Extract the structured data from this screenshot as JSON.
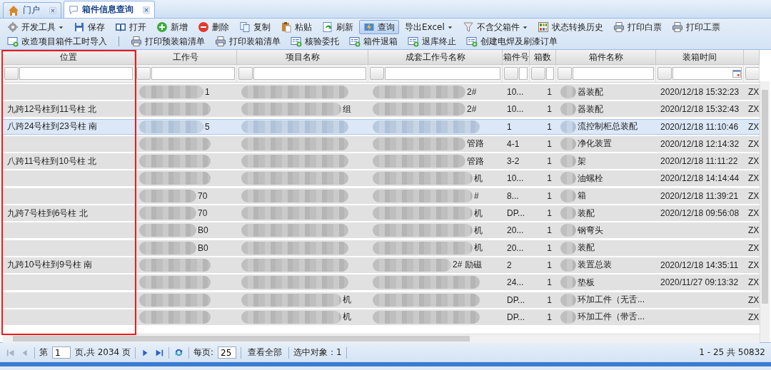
{
  "tabs": [
    {
      "label": "门户",
      "selected": false
    },
    {
      "label": "箱件信息查询",
      "selected": true
    }
  ],
  "toolbar": [
    {
      "items": [
        {
          "label": "开发工具",
          "kind": "dropdown",
          "pressed": false
        },
        {
          "label": "保存",
          "kind": "button",
          "pressed": false
        },
        {
          "label": "打开",
          "kind": "button",
          "pressed": false
        },
        {
          "label": "新增",
          "kind": "button",
          "pressed": false
        },
        {
          "label": "删除",
          "kind": "button",
          "pressed": false
        },
        {
          "label": "复制",
          "kind": "button",
          "pressed": false
        },
        {
          "label": "粘贴",
          "kind": "button",
          "pressed": false
        },
        {
          "label": "刷新",
          "kind": "button",
          "pressed": false
        },
        {
          "label": "查询",
          "kind": "button",
          "pressed": true
        },
        {
          "label": "导出Excel",
          "kind": "dropdown",
          "pressed": false
        },
        {
          "label": "不含父箱件",
          "kind": "dropdown",
          "pressed": false
        },
        {
          "label": "状态转换历史",
          "kind": "button",
          "pressed": false
        },
        {
          "label": "打印白票",
          "kind": "button",
          "pressed": false
        },
        {
          "label": "打印工票",
          "kind": "button",
          "pressed": false
        }
      ]
    },
    {
      "items": [
        {
          "label": "改造项目箱件工时导入",
          "kind": "button",
          "pressed": false
        },
        {
          "kind": "separator"
        },
        {
          "label": "打印预装箱清单",
          "kind": "button",
          "pressed": false
        },
        {
          "label": "打印装箱清单",
          "kind": "button",
          "pressed": false
        },
        {
          "label": "核验委托",
          "kind": "button",
          "pressed": false
        },
        {
          "label": "箱件退箱",
          "kind": "button",
          "pressed": false
        },
        {
          "label": "退库终止",
          "kind": "button",
          "pressed": false
        },
        {
          "label": "创建电焊及刷漆订单",
          "kind": "button",
          "pressed": false
        }
      ]
    }
  ],
  "grid": {
    "columns": [
      {
        "label": "位置",
        "highlighted": true,
        "date_picker": false
      },
      {
        "label": "工作号",
        "highlighted": false,
        "date_picker": false
      },
      {
        "label": "项目名称",
        "highlighted": false,
        "date_picker": false
      },
      {
        "label": "成套工作号名称",
        "highlighted": false,
        "date_picker": false
      },
      {
        "label": "箱件号",
        "highlighted": false,
        "date_picker": false
      },
      {
        "label": "箱数",
        "highlighted": false,
        "date_picker": false
      },
      {
        "label": "箱件名称",
        "highlighted": false,
        "date_picker": false
      },
      {
        "label": "装箱时间",
        "highlighted": false,
        "date_picker": true
      }
    ],
    "rows": [
      {
        "selected": false,
        "redacted": true,
        "cells": [
          "",
          "1",
          "",
          "2#",
          "10...",
          "1",
          "器装配",
          "2020/12/18 15:32:23",
          "ZX"
        ]
      },
      {
        "selected": false,
        "redacted": true,
        "cells": [
          "九跨12号柱到11号柱 北",
          "",
          "组",
          "2#",
          "10...",
          "1",
          "器装配",
          "2020/12/18 15:32:43",
          "ZX"
        ]
      },
      {
        "selected": true,
        "redacted": true,
        "cells": [
          "八跨24号柱到23号柱 南",
          "5",
          "",
          "",
          "1",
          "1",
          "流控制柜总装配",
          "2020/12/18 11:10:46",
          "ZX"
        ]
      },
      {
        "selected": false,
        "redacted": true,
        "cells": [
          "",
          "",
          "",
          "管路",
          "4-1",
          "1",
          "净化装置",
          "2020/12/18 12:14:32",
          "ZX"
        ]
      },
      {
        "selected": false,
        "redacted": true,
        "cells": [
          "八跨11号柱到10号柱 北",
          "",
          "",
          "管路",
          "3-2",
          "1",
          "架",
          "2020/12/18 11:11:22",
          "ZX"
        ]
      },
      {
        "selected": false,
        "redacted": true,
        "cells": [
          "",
          "",
          "",
          "机",
          "10...",
          "1",
          "油螺栓",
          "2020/12/18 14:14:44",
          "ZX"
        ]
      },
      {
        "selected": false,
        "redacted": true,
        "cells": [
          "",
          "70",
          "",
          "#",
          "8...",
          "1",
          "箱",
          "2020/12/18 11:39:21",
          "ZX"
        ]
      },
      {
        "selected": false,
        "redacted": true,
        "cells": [
          "九跨7号柱到6号柱 北",
          "70",
          "",
          "机",
          "DP...",
          "1",
          "装配",
          "2020/12/18 09:56:08",
          "ZX"
        ]
      },
      {
        "selected": false,
        "redacted": true,
        "cells": [
          "",
          "B0",
          "",
          "机",
          "20...",
          "1",
          "钢弯头",
          "",
          "ZX"
        ]
      },
      {
        "selected": false,
        "redacted": true,
        "cells": [
          "",
          "B0",
          "",
          "机",
          "20...",
          "1",
          "装配",
          "",
          "ZX"
        ]
      },
      {
        "selected": false,
        "redacted": true,
        "cells": [
          "九跨10号柱到9号柱 南",
          "",
          "",
          "2# 励磁",
          "2",
          "1",
          "装置总装",
          "2020/12/18 14:35:11",
          "ZX"
        ]
      },
      {
        "selected": false,
        "redacted": true,
        "cells": [
          "",
          "",
          "",
          "",
          "24...",
          "1",
          "垫板",
          "2020/11/27 09:13:32",
          "ZX"
        ]
      },
      {
        "selected": false,
        "redacted": true,
        "cells": [
          "",
          "",
          "机",
          "",
          "DP...",
          "1",
          "环加工件（无舌...",
          "",
          "ZX"
        ]
      },
      {
        "selected": false,
        "redacted": true,
        "cells": [
          "",
          "",
          "机",
          "",
          "DP...",
          "1",
          "环加工件（带舌...",
          "",
          "ZX"
        ]
      }
    ]
  },
  "pager": {
    "nav": [
      {
        "kind": "first",
        "disabled": true
      },
      {
        "kind": "prev",
        "disabled": true
      },
      {
        "kind": "next",
        "disabled": false
      },
      {
        "kind": "last",
        "disabled": false
      }
    ],
    "page_label": "第",
    "page": "1",
    "page_total": "页,共 2034 页",
    "per_page_label": "每页:",
    "per_page": "25",
    "show_all": "查看全部",
    "selection": "选中对象：1",
    "summary": "1 - 25 共 50832"
  }
}
